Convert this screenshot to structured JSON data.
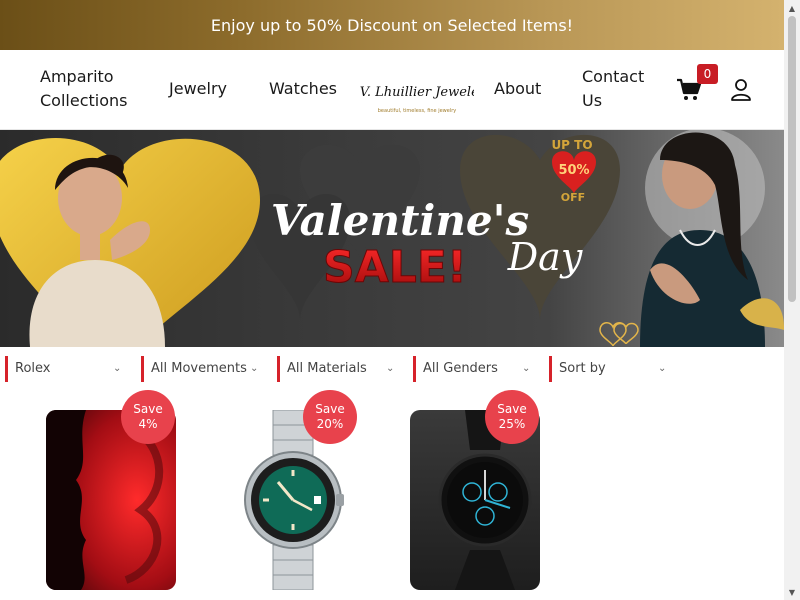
{
  "promo": {
    "text": "Enjoy up to 50% Discount on Selected Items!"
  },
  "nav": {
    "collections_line1": "Amparito",
    "collections_line2": "Collections",
    "jewelry": "Jewelry",
    "watches": "Watches",
    "logo_main": "M.V. Lhuillier Jewelers",
    "logo_tagline": "beautiful, timeless, fine jewelry",
    "about": "About",
    "contact_line1": "Contact",
    "contact_line2": "Us",
    "cart_count": "0"
  },
  "hero": {
    "title_script": "Valentine's",
    "title_day": "Day",
    "title_sale": "SALE!",
    "promo_up_to": "UP TO",
    "promo_pct": "50%",
    "promo_off": "OFF"
  },
  "filters": [
    {
      "label": "Rolex"
    },
    {
      "label": "All Movements"
    },
    {
      "label": "All Materials"
    },
    {
      "label": "All Genders"
    },
    {
      "label": "Sort by"
    }
  ],
  "products": [
    {
      "badge_line1": "Save",
      "badge_line2": "4%"
    },
    {
      "badge_line1": "Save",
      "badge_line2": "20%"
    },
    {
      "badge_line1": "Save",
      "badge_line2": "25%"
    }
  ],
  "colors": {
    "promo_gradient_start": "#6b4f17",
    "promo_gradient_end": "#d4b26e",
    "accent_red": "#d6222a",
    "badge_red": "#e8424c",
    "cart_badge": "#c81d25"
  },
  "icons": [
    "cart-icon",
    "user-icon",
    "chevron-down-icon",
    "heart-icon"
  ]
}
